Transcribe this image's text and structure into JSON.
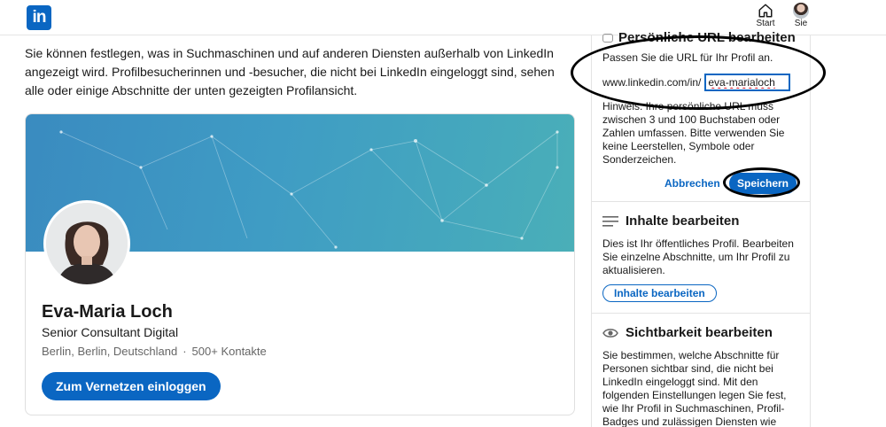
{
  "nav": {
    "logo_text": "in",
    "start_label": "Start",
    "me_label": "Sie"
  },
  "intro_text": "Sie können festlegen, was in Suchmaschinen und auf anderen Diensten außerhalb von LinkedIn angezeigt wird. Profilbesucherinnen und -besucher, die nicht bei LinkedIn eingeloggt sind, sehen alle oder einige Abschnitte der unten gezeigten Profilansicht.",
  "profile": {
    "name": "Eva-Maria Loch",
    "headline": "Senior Consultant Digital",
    "location": "Berlin, Berlin, Deutschland",
    "connections": "500+ Kontakte",
    "join_button": "Zum Vernetzen einloggen"
  },
  "url_section": {
    "title": "Persönliche URL bearbeiten",
    "prompt": "Passen Sie die URL für Ihr Profil an.",
    "prefix": "www.linkedin.com/in/",
    "value": "eva-marialoch",
    "hint": "Hinweis: Ihre persönliche URL muss zwischen 3 und 100 Buchstaben oder Zahlen umfassen. Bitte verwenden Sie keine Leerstellen, Symbole oder Sonderzeichen.",
    "cancel_label": "Abbrechen",
    "save_label": "Speichern"
  },
  "content_section": {
    "title": "Inhalte bearbeiten",
    "text": "Dies ist Ihr öffentliches Profil. Bearbeiten Sie einzelne Abschnitte, um Ihr Profil zu aktualisieren.",
    "button": "Inhalte bearbeiten"
  },
  "visibility_section": {
    "title": "Sichtbarkeit bearbeiten",
    "text": "Sie bestimmen, welche Abschnitte für Personen sichtbar sind, die nicht bei LinkedIn eingeloggt sind. Mit den folgenden Einstellungen legen Sie fest, wie Ihr Profil in Suchmaschinen, Profil-Badges und zulässigen Diensten wie Outlook angezeigt"
  },
  "colors": {
    "brand": "#0a66c2",
    "banner": "#3f9cc4"
  }
}
